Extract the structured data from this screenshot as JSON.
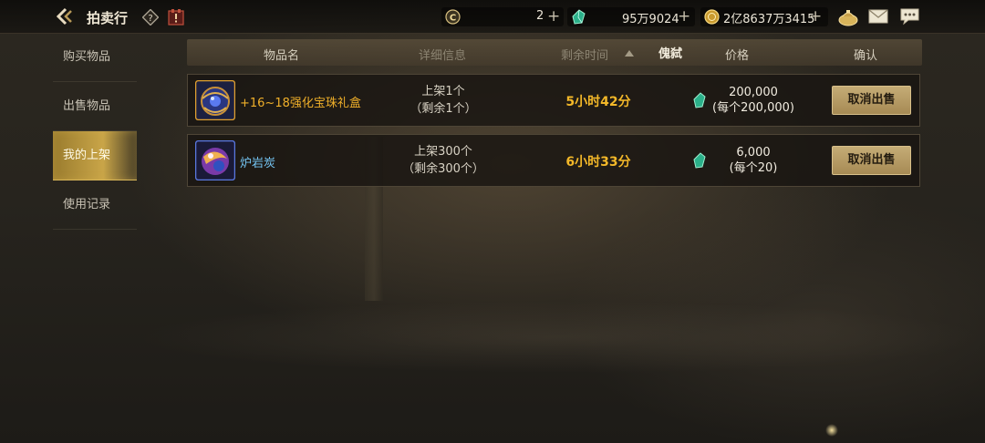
{
  "header": {
    "title": "拍卖行",
    "currencies": [
      {
        "icon": "c-coin-icon",
        "value": "2"
      },
      {
        "icon": "green-gem-icon",
        "value": "95万9024"
      },
      {
        "icon": "gold-coin-icon",
        "value": "2亿8637万3415"
      }
    ]
  },
  "sidebar": {
    "items": [
      {
        "label": "购买物品"
      },
      {
        "label": "出售物品"
      },
      {
        "label": "我的上架"
      },
      {
        "label": "使用记录"
      }
    ],
    "active_index": 2
  },
  "table": {
    "columns": {
      "name": "物品名",
      "detail": "详细信息",
      "time": "剩余时间",
      "seller": "傀弑",
      "price": "价格",
      "confirm": "确认"
    },
    "rows": [
      {
        "name": "+16~18强化宝珠礼盒",
        "listed": "上架1个",
        "remaining": "（剩余1个）",
        "time_left": "5小时42分",
        "price": "200,000",
        "unit_price": "(每个200,000)",
        "action": "取消出售",
        "name_color": "#f0b02a"
      },
      {
        "name": "炉岩炭",
        "listed": "上架300个",
        "remaining": "（剩余300个）",
        "time_left": "6小时33分",
        "price": "6,000",
        "unit_price": "(每个20)",
        "action": "取消出售",
        "name_color": "#74c4f2"
      }
    ]
  }
}
